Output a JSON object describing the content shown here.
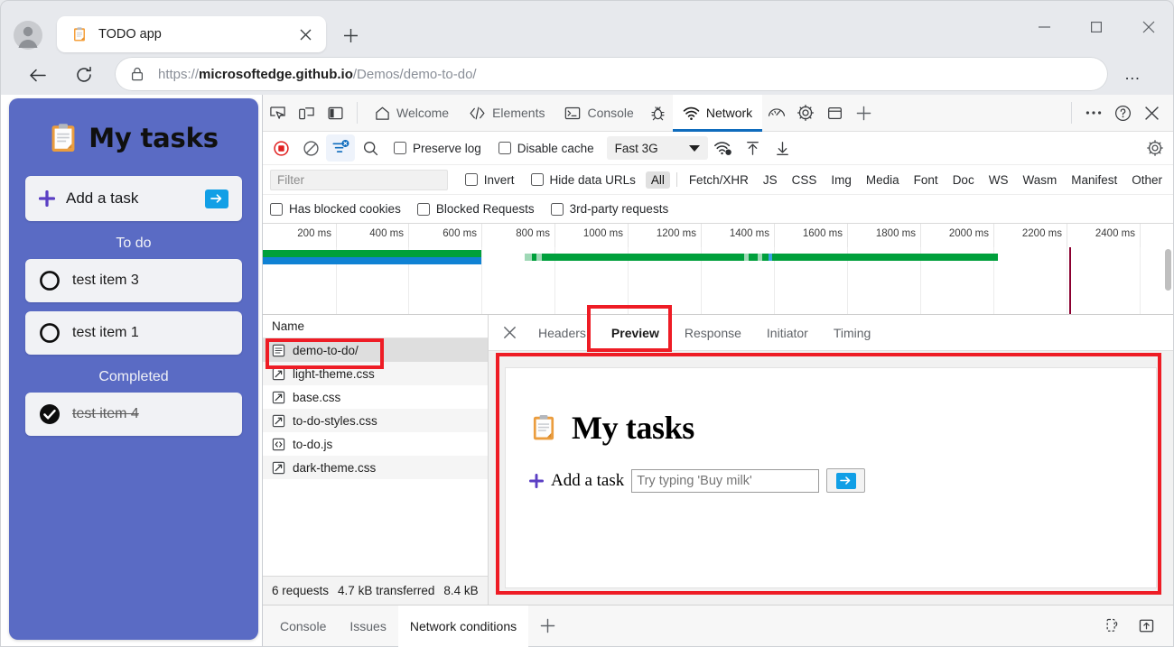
{
  "browser": {
    "tab": {
      "title": "TODO app",
      "favicon": "clipboard-icon",
      "close": "×"
    },
    "new_tab_label": "+",
    "window_controls": {
      "minimize": "—",
      "maximize": "▢",
      "close": "✕"
    },
    "nav": {
      "back": "←",
      "reload": "⟳",
      "more": "…"
    },
    "address": {
      "lock": "lock-icon",
      "scheme": "https://",
      "host": "microsoftedge.github.io",
      "path": "/Demos/demo-to-do/"
    }
  },
  "todo_app": {
    "title": "My tasks",
    "add_task_label": "Add a task",
    "submit_label": "➡",
    "sections": [
      {
        "heading": "To do",
        "items": [
          {
            "label": "test item 3",
            "done": false
          },
          {
            "label": "test item 1",
            "done": false
          }
        ]
      },
      {
        "heading": "Completed",
        "items": [
          {
            "label": "test item 4",
            "done": true
          }
        ]
      }
    ]
  },
  "devtools": {
    "panel_tabs": [
      {
        "label": "Welcome",
        "icon": "home-icon",
        "active": false
      },
      {
        "label": "Elements",
        "icon": "code-brackets-icon",
        "active": false
      },
      {
        "label": "Console",
        "icon": "console-prompt-icon",
        "active": false
      },
      {
        "label": "Network",
        "icon": "network-wifi-icon",
        "active": true
      }
    ],
    "left_icons": [
      "inspect-element-icon",
      "device-emulation-icon",
      "dock-side-icon"
    ],
    "right_icons": [
      "debugger-bug-icon",
      "performance-gauge-icon",
      "application-gear-icon",
      "memory-panel-icon",
      "more-panels-plus-icon"
    ],
    "window_actions": [
      "more-tools-icon",
      "help-icon",
      "close-devtools-icon"
    ],
    "network_toolbar": {
      "record": "record-stop-icon",
      "clear": "clear-icon",
      "filter_toggle": "filter-icon",
      "search": "search-icon",
      "preserve_log": "Preserve log",
      "disable_cache": "Disable cache",
      "throttle_value": "Fast 3G",
      "import_har": "import-har-icon",
      "export_har": "export-har-icon",
      "network_settings": "network-conditions-icon",
      "settings": "settings-gear-icon"
    },
    "filter_bar": {
      "placeholder": "Filter",
      "invert": "Invert",
      "hide_data_urls": "Hide data URLs",
      "types": [
        "All",
        "Fetch/XHR",
        "JS",
        "CSS",
        "Img",
        "Media",
        "Font",
        "Doc",
        "WS",
        "Wasm",
        "Manifest",
        "Other"
      ],
      "active_type": "All"
    },
    "filter_bar2": {
      "has_blocked_cookies": "Has blocked cookies",
      "blocked_requests": "Blocked Requests",
      "third_party_requests": "3rd-party requests"
    },
    "overview": {
      "ticks": [
        "200 ms",
        "400 ms",
        "600 ms",
        "800 ms",
        "1000 ms",
        "1200 ms",
        "1400 ms",
        "1600 ms",
        "1800 ms",
        "2000 ms",
        "2200 ms",
        "2400 ms"
      ],
      "colors": {
        "green": "#00a03c",
        "blue": "#0f82d4",
        "marker": "#8b0030"
      }
    },
    "requests": {
      "column_header": "Name",
      "rows": [
        {
          "name": "demo-to-do/",
          "icon": "document-icon",
          "selected": true
        },
        {
          "name": "light-theme.css",
          "icon": "stylesheet-icon",
          "selected": false
        },
        {
          "name": "base.css",
          "icon": "stylesheet-icon",
          "selected": false
        },
        {
          "name": "to-do-styles.css",
          "icon": "stylesheet-icon",
          "selected": false
        },
        {
          "name": "to-do.js",
          "icon": "script-icon",
          "selected": false
        },
        {
          "name": "dark-theme.css",
          "icon": "stylesheet-icon",
          "selected": false
        }
      ],
      "status": {
        "count": "6 requests",
        "transferred": "4.7 kB transferred",
        "resources": "8.4 kB"
      }
    },
    "detail": {
      "close": "✕",
      "tabs": [
        {
          "label": "Headers",
          "active": false
        },
        {
          "label": "Preview",
          "active": true
        },
        {
          "label": "Response",
          "active": false
        },
        {
          "label": "Initiator",
          "active": false
        },
        {
          "label": "Timing",
          "active": false
        }
      ],
      "preview": {
        "title": "My tasks",
        "add_task_label": "Add a task",
        "input_placeholder": "Try typing 'Buy milk'",
        "submit_label": "➡"
      }
    },
    "drawer": {
      "tabs": [
        {
          "label": "Console",
          "active": false
        },
        {
          "label": "Issues",
          "active": false
        },
        {
          "label": "Network conditions",
          "active": true
        }
      ],
      "add_tab": "+",
      "right_icons": [
        "devices-icon",
        "dock-drawer-icon"
      ]
    }
  },
  "annotations": {
    "accent_red": "#ee1c25",
    "boxes": [
      "selected-request-highlight",
      "preview-tab-highlight",
      "preview-body-highlight"
    ]
  }
}
